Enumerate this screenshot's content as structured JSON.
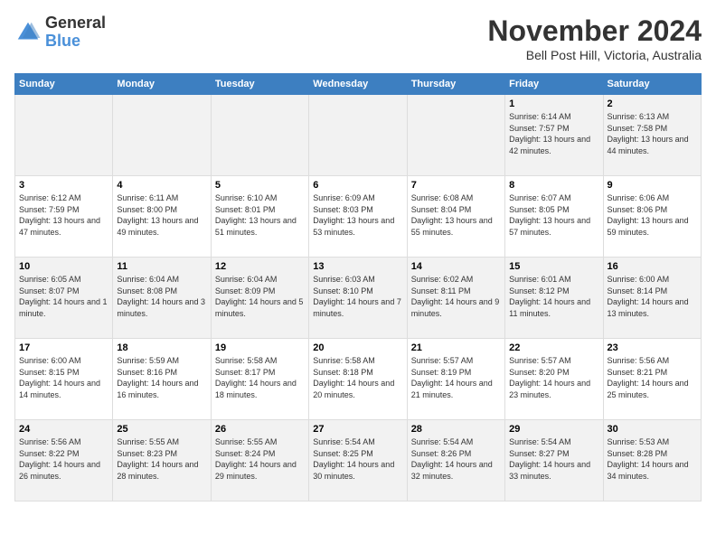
{
  "logo": {
    "text_general": "General",
    "text_blue": "Blue"
  },
  "header": {
    "month": "November 2024",
    "location": "Bell Post Hill, Victoria, Australia"
  },
  "days_of_week": [
    "Sunday",
    "Monday",
    "Tuesday",
    "Wednesday",
    "Thursday",
    "Friday",
    "Saturday"
  ],
  "weeks": [
    [
      {
        "day": "",
        "sunrise": "",
        "sunset": "",
        "daylight": ""
      },
      {
        "day": "",
        "sunrise": "",
        "sunset": "",
        "daylight": ""
      },
      {
        "day": "",
        "sunrise": "",
        "sunset": "",
        "daylight": ""
      },
      {
        "day": "",
        "sunrise": "",
        "sunset": "",
        "daylight": ""
      },
      {
        "day": "",
        "sunrise": "",
        "sunset": "",
        "daylight": ""
      },
      {
        "day": "1",
        "sunrise": "6:14 AM",
        "sunset": "7:57 PM",
        "daylight": "13 hours and 42 minutes."
      },
      {
        "day": "2",
        "sunrise": "6:13 AM",
        "sunset": "7:58 PM",
        "daylight": "13 hours and 44 minutes."
      }
    ],
    [
      {
        "day": "3",
        "sunrise": "6:12 AM",
        "sunset": "7:59 PM",
        "daylight": "13 hours and 47 minutes."
      },
      {
        "day": "4",
        "sunrise": "6:11 AM",
        "sunset": "8:00 PM",
        "daylight": "13 hours and 49 minutes."
      },
      {
        "day": "5",
        "sunrise": "6:10 AM",
        "sunset": "8:01 PM",
        "daylight": "13 hours and 51 minutes."
      },
      {
        "day": "6",
        "sunrise": "6:09 AM",
        "sunset": "8:03 PM",
        "daylight": "13 hours and 53 minutes."
      },
      {
        "day": "7",
        "sunrise": "6:08 AM",
        "sunset": "8:04 PM",
        "daylight": "13 hours and 55 minutes."
      },
      {
        "day": "8",
        "sunrise": "6:07 AM",
        "sunset": "8:05 PM",
        "daylight": "13 hours and 57 minutes."
      },
      {
        "day": "9",
        "sunrise": "6:06 AM",
        "sunset": "8:06 PM",
        "daylight": "13 hours and 59 minutes."
      }
    ],
    [
      {
        "day": "10",
        "sunrise": "6:05 AM",
        "sunset": "8:07 PM",
        "daylight": "14 hours and 1 minute."
      },
      {
        "day": "11",
        "sunrise": "6:04 AM",
        "sunset": "8:08 PM",
        "daylight": "14 hours and 3 minutes."
      },
      {
        "day": "12",
        "sunrise": "6:04 AM",
        "sunset": "8:09 PM",
        "daylight": "14 hours and 5 minutes."
      },
      {
        "day": "13",
        "sunrise": "6:03 AM",
        "sunset": "8:10 PM",
        "daylight": "14 hours and 7 minutes."
      },
      {
        "day": "14",
        "sunrise": "6:02 AM",
        "sunset": "8:11 PM",
        "daylight": "14 hours and 9 minutes."
      },
      {
        "day": "15",
        "sunrise": "6:01 AM",
        "sunset": "8:12 PM",
        "daylight": "14 hours and 11 minutes."
      },
      {
        "day": "16",
        "sunrise": "6:00 AM",
        "sunset": "8:14 PM",
        "daylight": "14 hours and 13 minutes."
      }
    ],
    [
      {
        "day": "17",
        "sunrise": "6:00 AM",
        "sunset": "8:15 PM",
        "daylight": "14 hours and 14 minutes."
      },
      {
        "day": "18",
        "sunrise": "5:59 AM",
        "sunset": "8:16 PM",
        "daylight": "14 hours and 16 minutes."
      },
      {
        "day": "19",
        "sunrise": "5:58 AM",
        "sunset": "8:17 PM",
        "daylight": "14 hours and 18 minutes."
      },
      {
        "day": "20",
        "sunrise": "5:58 AM",
        "sunset": "8:18 PM",
        "daylight": "14 hours and 20 minutes."
      },
      {
        "day": "21",
        "sunrise": "5:57 AM",
        "sunset": "8:19 PM",
        "daylight": "14 hours and 21 minutes."
      },
      {
        "day": "22",
        "sunrise": "5:57 AM",
        "sunset": "8:20 PM",
        "daylight": "14 hours and 23 minutes."
      },
      {
        "day": "23",
        "sunrise": "5:56 AM",
        "sunset": "8:21 PM",
        "daylight": "14 hours and 25 minutes."
      }
    ],
    [
      {
        "day": "24",
        "sunrise": "5:56 AM",
        "sunset": "8:22 PM",
        "daylight": "14 hours and 26 minutes."
      },
      {
        "day": "25",
        "sunrise": "5:55 AM",
        "sunset": "8:23 PM",
        "daylight": "14 hours and 28 minutes."
      },
      {
        "day": "26",
        "sunrise": "5:55 AM",
        "sunset": "8:24 PM",
        "daylight": "14 hours and 29 minutes."
      },
      {
        "day": "27",
        "sunrise": "5:54 AM",
        "sunset": "8:25 PM",
        "daylight": "14 hours and 30 minutes."
      },
      {
        "day": "28",
        "sunrise": "5:54 AM",
        "sunset": "8:26 PM",
        "daylight": "14 hours and 32 minutes."
      },
      {
        "day": "29",
        "sunrise": "5:54 AM",
        "sunset": "8:27 PM",
        "daylight": "14 hours and 33 minutes."
      },
      {
        "day": "30",
        "sunrise": "5:53 AM",
        "sunset": "8:28 PM",
        "daylight": "14 hours and 34 minutes."
      }
    ]
  ]
}
